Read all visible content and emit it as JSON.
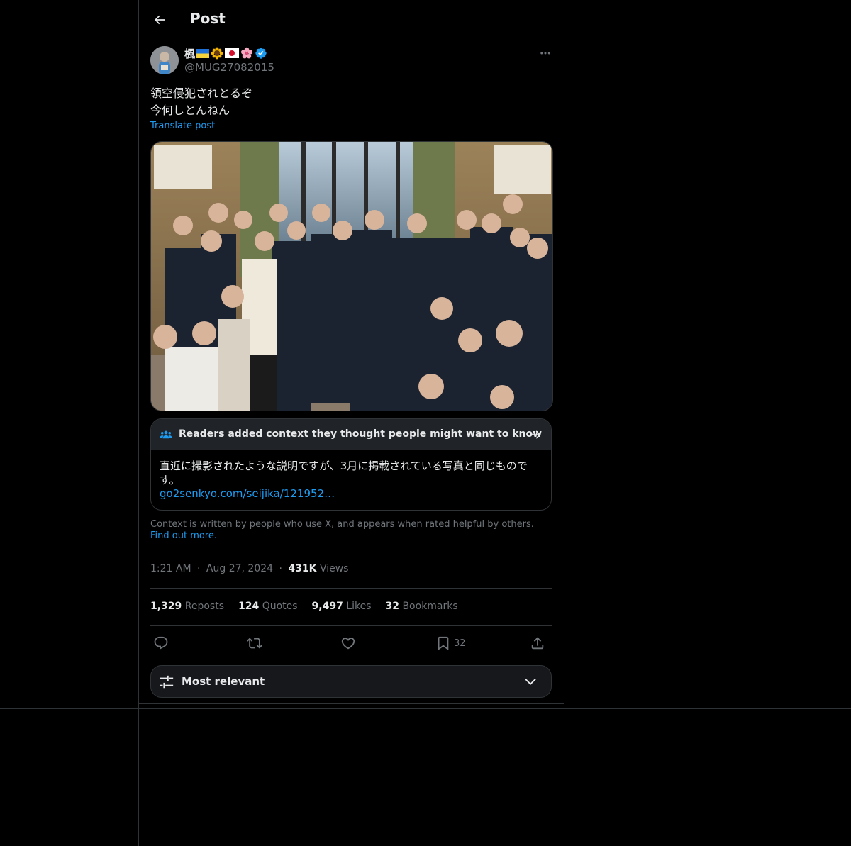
{
  "header": {
    "title": "Post",
    "back_icon": "arrow-left-icon"
  },
  "author": {
    "name": "楓",
    "name_emojis": [
      "ukraine-flag-icon",
      "sunflower-icon",
      "japan-flag-icon",
      "sakura-icon"
    ],
    "verified": true,
    "handle": "@MUG27082015"
  },
  "post": {
    "text_lines": [
      "領空侵犯されとるぞ",
      "今何しとんねん"
    ],
    "translate_label": "Translate post"
  },
  "community_note": {
    "header": "Readers added context they thought people might want to know",
    "body": "直近に撮影されたような説明ですが、3月に掲載されている写真と同じものです。",
    "link": "go2senkyo.com/seijika/121952…",
    "footer": "Context is written by people who use X, and appears when rated helpful by others.",
    "find_out_more": "Find out more."
  },
  "meta": {
    "time": "1:21 AM",
    "separator": "·",
    "date": "Aug 27, 2024",
    "views_count": "431K",
    "views_label": "Views"
  },
  "stats": [
    {
      "count": "1,329",
      "label": "Reposts"
    },
    {
      "count": "124",
      "label": "Quotes"
    },
    {
      "count": "9,497",
      "label": "Likes"
    },
    {
      "count": "32",
      "label": "Bookmarks"
    }
  ],
  "actions": {
    "bookmark_count": "32"
  },
  "sort": {
    "label": "Most relevant"
  },
  "colors": {
    "background": "#000000",
    "text": "#e7e9ea",
    "muted": "#71767b",
    "accent": "#1d9bf0",
    "border": "#2f3336",
    "note_header": "#202327"
  }
}
